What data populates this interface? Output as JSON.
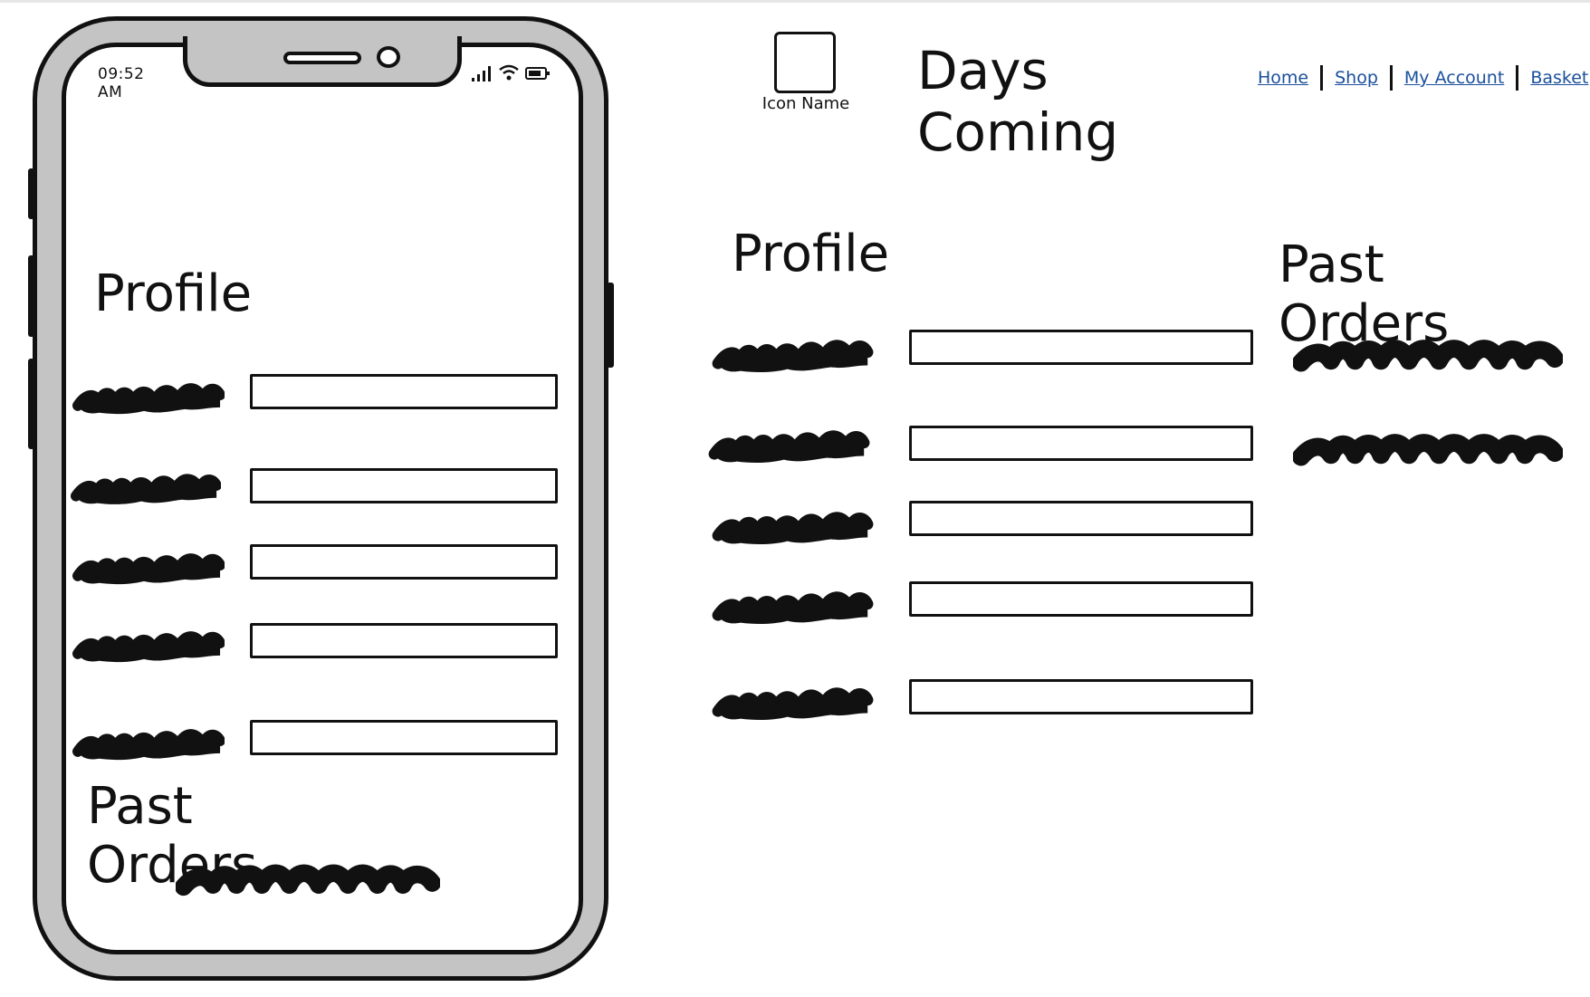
{
  "mobile": {
    "status_time": "09:52 AM",
    "profile_heading": "Profile",
    "past_orders_heading": "Past Orders",
    "profile_fields": [
      {
        "value": ""
      },
      {
        "value": ""
      },
      {
        "value": ""
      },
      {
        "value": ""
      },
      {
        "value": ""
      }
    ],
    "status_icons": [
      "signal-icon",
      "wifi-icon",
      "battery-icon"
    ]
  },
  "desktop": {
    "logo_label": "Icon Name",
    "site_title": "Days Coming",
    "nav": {
      "home": "Home",
      "shop": "Shop",
      "account": "My Account",
      "basket": "Basket"
    },
    "profile_heading": "Profile",
    "past_orders_heading": "Past Orders",
    "profile_fields": [
      {
        "value": ""
      },
      {
        "value": ""
      },
      {
        "value": ""
      },
      {
        "value": ""
      },
      {
        "value": ""
      }
    ]
  },
  "colors": {
    "phone_frame": "#c4c4c4",
    "ink": "#111111",
    "link": "#1a4f9c"
  }
}
